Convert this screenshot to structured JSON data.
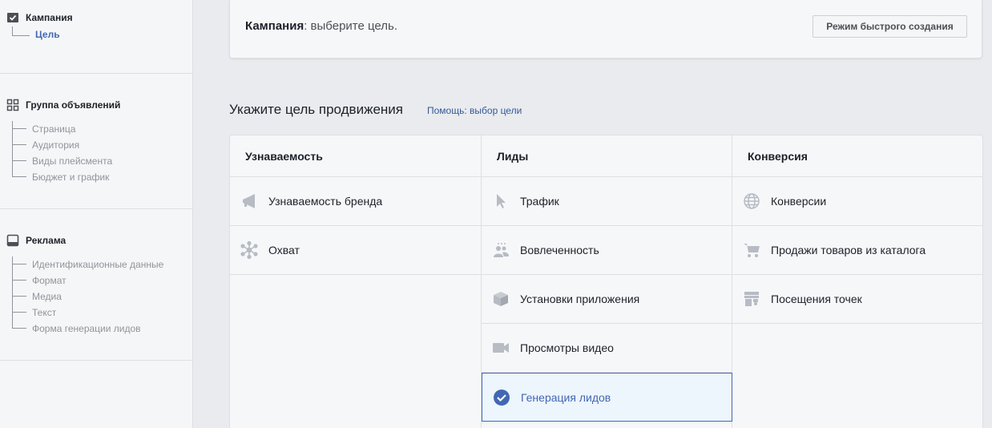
{
  "sidebar": {
    "campaign": {
      "label": "Кампания",
      "items": [
        "Цель"
      ]
    },
    "adset": {
      "label": "Группа объявлений",
      "items": [
        "Страница",
        "Аудитория",
        "Виды плейсмента",
        "Бюджет и график"
      ]
    },
    "ad": {
      "label": "Реклама",
      "items": [
        "Идентификационные данные",
        "Формат",
        "Медиа",
        "Текст",
        "Форма генерации лидов"
      ]
    }
  },
  "topcard": {
    "title_bold": "Кампания",
    "title_rest": ": выберите цель.",
    "quick_button": "Режим быстрого создания"
  },
  "goal": {
    "title": "Укажите цель продвижения",
    "help": "Помощь: выбор цели"
  },
  "columns": [
    {
      "header": "Узнаваемость",
      "items": [
        {
          "label": "Узнаваемость бренда",
          "icon": "megaphone-icon"
        },
        {
          "label": "Охват",
          "icon": "reach-icon"
        }
      ]
    },
    {
      "header": "Лиды",
      "items": [
        {
          "label": "Трафик",
          "icon": "cursor-icon"
        },
        {
          "label": "Вовлеченность",
          "icon": "people-icon"
        },
        {
          "label": "Установки приложения",
          "icon": "box-icon"
        },
        {
          "label": "Просмотры видео",
          "icon": "video-icon"
        },
        {
          "label": "Генерация лидов",
          "icon": "check-circle-icon",
          "selected": true
        }
      ]
    },
    {
      "header": "Конверсия",
      "items": [
        {
          "label": "Конверсии",
          "icon": "globe-icon"
        },
        {
          "label": "Продажи товаров из каталога",
          "icon": "cart-icon"
        },
        {
          "label": "Посещения точек",
          "icon": "store-icon"
        }
      ]
    }
  ],
  "colors": {
    "accent": "#4267b2",
    "link": "#365899",
    "muted": "#90949c"
  }
}
